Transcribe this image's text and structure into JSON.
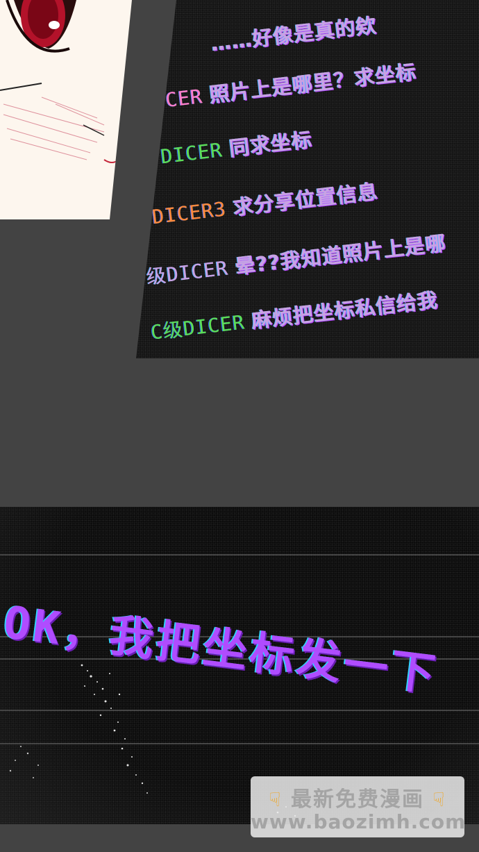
{
  "chat": {
    "lines": [
      {
        "user": "",
        "user_color": "#c9a1e3",
        "message": "……好像是真的欸"
      },
      {
        "user": "CER",
        "user_color": "#ff7ec8",
        "message": "照片上是哪里？求坐标"
      },
      {
        "user": "DICER",
        "user_color": "#5dde54",
        "message": "同求坐标"
      },
      {
        "user": "DICER3",
        "user_color": "#ff8a3a",
        "message": "求分享位置信息"
      },
      {
        "user": "级DICER",
        "user_color": "#c9a1e3",
        "message": "晕??我知道照片上是哪"
      },
      {
        "user": "C级DICER",
        "user_color": "#5dde54",
        "message": "麻烦把坐标私信给我"
      }
    ]
  },
  "terminal": {
    "message": "OK，我把坐标发一下",
    "text_color": "#b04cff",
    "shadow_color": "#33d1ff"
  },
  "watermark": {
    "icon": "pointing-down-hand-icon",
    "title": "最新免费漫画",
    "url": "www.baozimh.com"
  }
}
